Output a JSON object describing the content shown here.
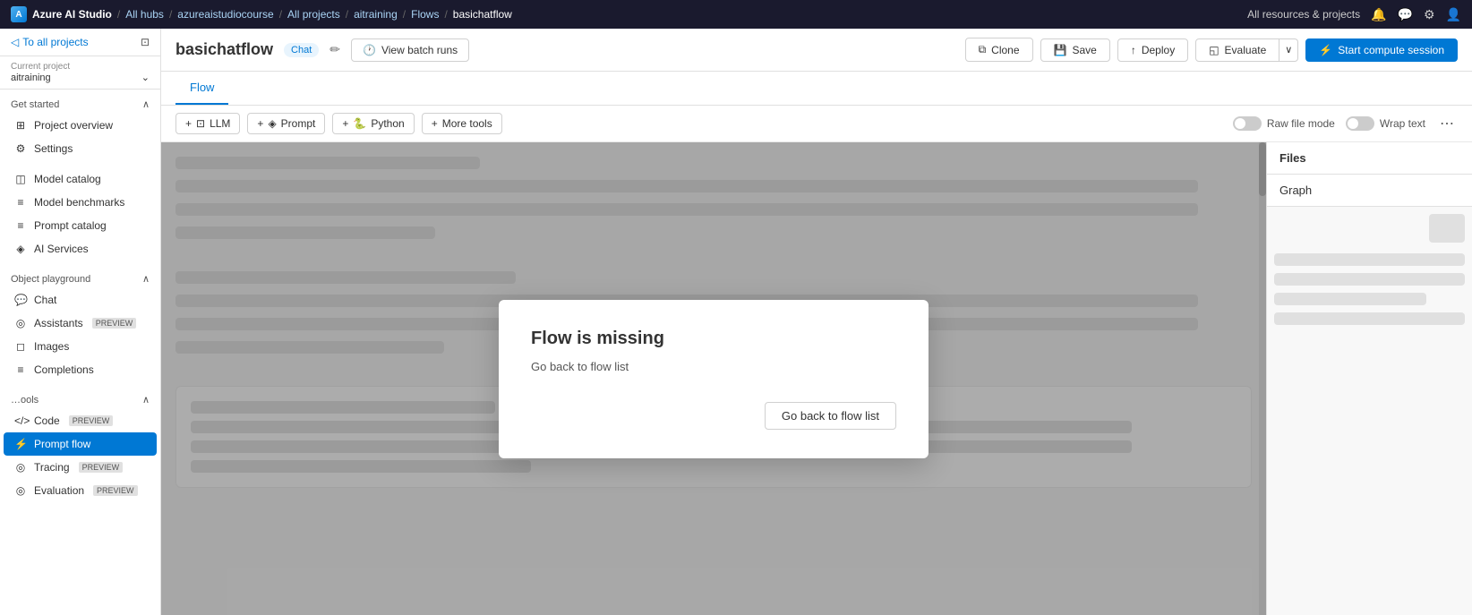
{
  "topnav": {
    "brand": "Azure AI Studio",
    "breadcrumbs": [
      "All hubs",
      "azureaistudiocourse",
      "All projects",
      "aitraining",
      "Flows",
      "basichatflow"
    ],
    "resources_label": "All resources & projects"
  },
  "sidebar": {
    "back_label": "To all projects",
    "current_project_label": "Current project",
    "project_name": "aitraining",
    "sections": [
      {
        "name": "get_started",
        "label": "Get started",
        "collapsible": true,
        "items": [
          {
            "id": "project-overview",
            "label": "Project overview",
            "icon": "⊞"
          },
          {
            "id": "settings",
            "label": "Settings",
            "icon": "⚙"
          }
        ]
      },
      {
        "name": "build",
        "label": "",
        "collapsible": false,
        "items": [
          {
            "id": "model-catalog",
            "label": "Model catalog",
            "icon": "◫"
          },
          {
            "id": "model-benchmarks",
            "label": "Model benchmarks",
            "icon": "≡"
          },
          {
            "id": "prompt-catalog",
            "label": "Prompt catalog",
            "icon": "≡"
          },
          {
            "id": "ai-services",
            "label": "AI Services",
            "icon": "◈"
          }
        ]
      },
      {
        "name": "playground",
        "label": "Object playground",
        "collapsible": true,
        "items": [
          {
            "id": "chat",
            "label": "Chat",
            "icon": "💬"
          },
          {
            "id": "assistants",
            "label": "Assistants",
            "icon": "◎",
            "badge": "PREVIEW"
          },
          {
            "id": "images",
            "label": "Images",
            "icon": "◻"
          },
          {
            "id": "completions",
            "label": "Completions",
            "icon": "≡"
          }
        ]
      },
      {
        "name": "tools",
        "label": "ools",
        "collapsible": true,
        "items": [
          {
            "id": "code",
            "label": "Code",
            "icon": "</>",
            "badge": "PREVIEW"
          },
          {
            "id": "prompt-flow",
            "label": "Prompt flow",
            "icon": "⚡",
            "active": true
          },
          {
            "id": "tracing",
            "label": "Tracing",
            "icon": "◎",
            "badge": "PREVIEW"
          },
          {
            "id": "evaluation",
            "label": "Evaluation",
            "icon": "◎",
            "badge": "PREVIEW"
          }
        ]
      }
    ]
  },
  "header": {
    "title": "basichatflow",
    "badge": "Chat",
    "view_batch_runs": "View batch runs",
    "clone_label": "Clone",
    "save_label": "Save",
    "deploy_label": "Deploy",
    "evaluate_label": "Evaluate",
    "start_compute_label": "Start compute session"
  },
  "tabs": [
    {
      "id": "flow",
      "label": "Flow",
      "active": true
    }
  ],
  "toolbar": {
    "llm_btn": "LLM",
    "prompt_btn": "Prompt",
    "python_btn": "Python",
    "more_tools_btn": "More tools",
    "raw_file_mode": "Raw file mode",
    "wrap_text": "Wrap text"
  },
  "modal": {
    "title": "Flow is missing",
    "body": "Go back to flow list",
    "button_label": "Go back to flow list"
  },
  "right_panel": {
    "files_label": "Files",
    "graph_label": "Graph"
  }
}
